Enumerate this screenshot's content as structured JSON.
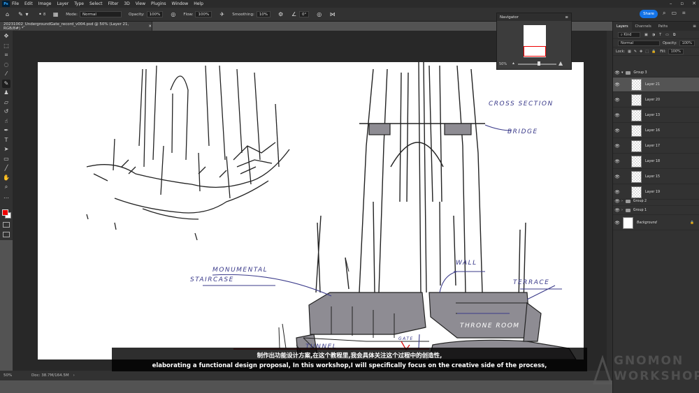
{
  "app": {
    "logo": "Ps"
  },
  "menu": [
    "File",
    "Edit",
    "Image",
    "Layer",
    "Type",
    "Select",
    "Filter",
    "3D",
    "View",
    "Plugins",
    "Window",
    "Help"
  ],
  "options": {
    "brush_size": "8",
    "mode_label": "Mode:",
    "mode_value": "Normal",
    "opacity_label": "Opacity:",
    "opacity_value": "100%",
    "flow_label": "Flow:",
    "flow_value": "100%",
    "smoothing_label": "Smoothing:",
    "smoothing_value": "10%",
    "angle_value": "0°",
    "share_label": "Share"
  },
  "document": {
    "tab_title": "20231002_UndergroundGate_record_v004.psd @ 50% (Layer 21, RGB/8#) *",
    "zoom": "50%",
    "doc_info": "Doc: 38.7M/164.5M"
  },
  "navigator": {
    "title": "Navigator",
    "zoom": "50%"
  },
  "panels": {
    "tabs": [
      "Layers",
      "Channels",
      "Paths"
    ],
    "kind_label": "Kind",
    "blend_mode": "Normal",
    "opacity_label": "Opacity:",
    "opacity_value": "100%",
    "lock_label": "Lock:",
    "fill_label": "Fill:",
    "fill_value": "100%"
  },
  "layers": {
    "group3": "Group 3",
    "items": [
      "Layer 21",
      "Layer 20",
      "Layer 13",
      "Layer 16",
      "Layer 17",
      "Layer 18",
      "Layer 15",
      "Layer 19"
    ],
    "group2": "Group 2",
    "group1": "Group 1",
    "background": "Background"
  },
  "sketch_labels": {
    "cross_section": "CROSS SECTION",
    "bridge": "BRIDGE",
    "monumental": "MONUMENTAL",
    "staircase": "STAIRCASE",
    "wall": "WALL",
    "terrace": "TERRACE",
    "throne_room": "THRONE ROOM",
    "tunnel": "TUNNEL",
    "gate": "GATE"
  },
  "subtitles": {
    "zh": "制作出功能设计方案,在这个教程里,我会具体关注这个过程中的创造性,",
    "en": "elaborating a functional design proposal, In this workshop,I will specifically focus on the creative side of the process,"
  },
  "watermark": {
    "line1": "GNOMON",
    "line2": "WORKSHOP"
  },
  "colors": {
    "foreground": "#e00000",
    "background": "#ffffff",
    "accent": "#1473e6"
  }
}
